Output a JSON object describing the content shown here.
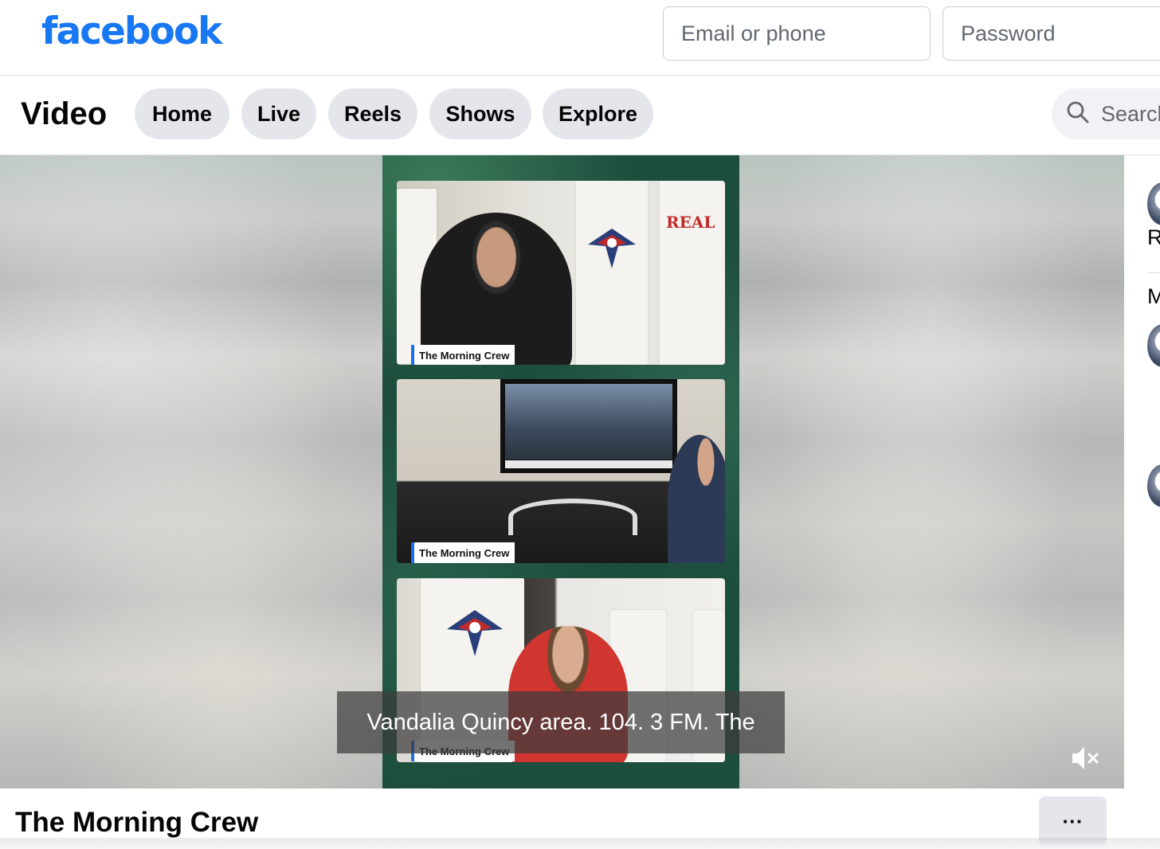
{
  "header": {
    "logo": "facebook",
    "email_placeholder": "Email or phone",
    "password_placeholder": "Password"
  },
  "nav": {
    "title": "Video",
    "tabs": [
      "Home",
      "Live",
      "Reels",
      "Shows",
      "Explore"
    ],
    "search_label": "Search"
  },
  "player": {
    "panel_label": "The Morning Crew",
    "caption": "Vandalia Quincy area. 104. 3 FM. The",
    "mute_icon": "speaker-muted-icon"
  },
  "side": {
    "letter_1": "R",
    "letter_2": "M"
  },
  "footer": {
    "video_title": "The Morning Crew",
    "more_label": "···"
  },
  "colors": {
    "brand": "#1877f2",
    "pill_bg": "#e4e6eb",
    "label_accent": "#1b6ef3"
  }
}
